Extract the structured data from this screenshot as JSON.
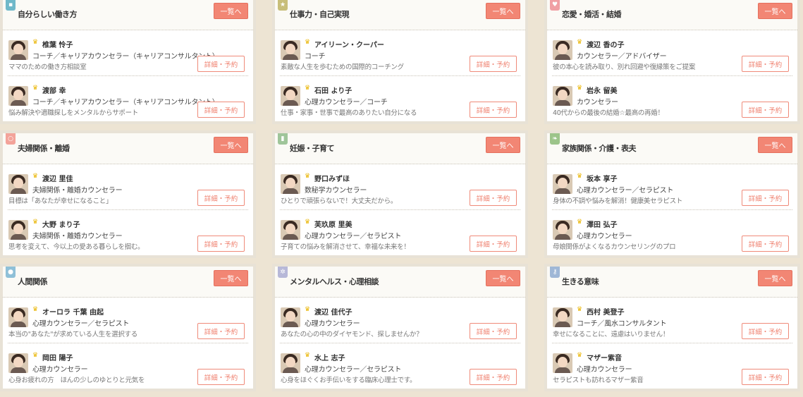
{
  "list_button_label": "一覧へ",
  "detail_button_label": "詳細・予約",
  "categories": [
    {
      "title": "自分らしい働き方",
      "icon": "briefcase-icon",
      "icon_glyph": "▪",
      "icon_color": "#6fb8c9",
      "counselors": [
        {
          "name": "椎葉 怜子",
          "role": "コーチ／キャリアカウンセラー（キャリアコンサルタント）",
          "desc": "ママのための働き方相談室"
        },
        {
          "name": "渡部 幸",
          "role": "コーチ／キャリアカウンセラー（キャリアコンサルタント）",
          "desc": "悩み解決や適職探しをメンタルからサポート"
        }
      ]
    },
    {
      "title": "仕事力・自己実現",
      "icon": "star-icon",
      "icon_glyph": "★",
      "icon_color": "#c8be7a",
      "counselors": [
        {
          "name": "アイリーン・クーパー",
          "role": "コーチ",
          "desc": "素敵な人生を歩むための国際的コーチング"
        },
        {
          "name": "石田 より子",
          "role": "心理カウンセラー／コーチ",
          "desc": "仕事・家事・世事で最高のありたい自分になる"
        }
      ]
    },
    {
      "title": "恋愛・婚活・結婚",
      "icon": "heart-icon",
      "icon_glyph": "♥",
      "icon_color": "#f0a0a4",
      "counselors": [
        {
          "name": "渡辺 香の子",
          "role": "カウンセラー／アドバイザー",
          "desc": "彼の本心を読み取り、別れ回避や復縁策をご提案"
        },
        {
          "name": "岩永 留美",
          "role": "カウンセラー",
          "desc": "40代からの最後の結婚☆最高の再婚！"
        }
      ]
    },
    {
      "title": "夫婦関係・離婚",
      "icon": "rings-icon",
      "icon_glyph": "○",
      "icon_color": "#f3a39a",
      "counselors": [
        {
          "name": "渡辺 里佳",
          "role": "夫婦関係・離婚カウンセラー",
          "desc": "目標は「あなたが幸せになること」"
        },
        {
          "name": "大野 まり子",
          "role": "夫婦関係・離婚カウンセラー",
          "desc": "思考を変えて、今以上の愛ある暮らしを掴む。"
        }
      ]
    },
    {
      "title": "妊娠・子育て",
      "icon": "baby-bottle-icon",
      "icon_glyph": "▮",
      "icon_color": "#9fc59a",
      "counselors": [
        {
          "name": "野口みずほ",
          "role": "数秘学カウンセラー",
          "desc": "ひとりで頑張らないで！大丈夫だから。"
        },
        {
          "name": "芙玖原 里美",
          "role": "心理カウンセラー／セラピスト",
          "desc": "子育ての悩みを解消させて、幸福な未来を！"
        }
      ]
    },
    {
      "title": "家族関係・介護・表夫",
      "icon": "leaf-icon",
      "icon_glyph": "❧",
      "icon_color": "#9cc48a",
      "counselors": [
        {
          "name": "坂本 享子",
          "role": "心理カウンセラー／セラピスト",
          "desc": "身体の不調や悩みを解消！健康美セラピスト"
        },
        {
          "name": "澤田 弘子",
          "role": "心理カウンセラー",
          "desc": "母娘関係がよくなるカウンセリングのプロ"
        }
      ]
    },
    {
      "title": "人間関係",
      "icon": "person-icon",
      "icon_glyph": "●",
      "icon_color": "#8fc0d8",
      "counselors": [
        {
          "name": "オーロラ 千葉 由起",
          "role": "心理カウンセラー／セラピスト",
          "desc": "本当の\"あなた\"が求めている人生を選択する"
        },
        {
          "name": "岡田 陽子",
          "role": "心理カウンセラー",
          "desc": "心身お疲れの方　ほんの少しのゆとりと元気を"
        }
      ]
    },
    {
      "title": "メンタルヘルス・心理相談",
      "icon": "sparkle-icon",
      "icon_glyph": "✲",
      "icon_color": "#b7b8d8",
      "counselors": [
        {
          "name": "渡辺 佳代子",
          "role": "心理カウンセラー",
          "desc": "あなたの心の中のダイヤモンド、探しませんか？"
        },
        {
          "name": "水上 志子",
          "role": "心理カウンセラー／セラピスト",
          "desc": "心身をほぐくお手伝いをする臨床心理士です。"
        }
      ]
    },
    {
      "title": "生きる意味",
      "icon": "key-icon",
      "icon_glyph": "⚷",
      "icon_color": "#9fb7d6",
      "counselors": [
        {
          "name": "西村 美登子",
          "role": "コーチ／風水コンサルタント",
          "desc": "幸せになることに、遠慮はいりません！"
        },
        {
          "name": "マザー紫音",
          "role": "心理カウンセラー",
          "desc": "セラピストも訪れるマザー紫音"
        }
      ]
    }
  ]
}
